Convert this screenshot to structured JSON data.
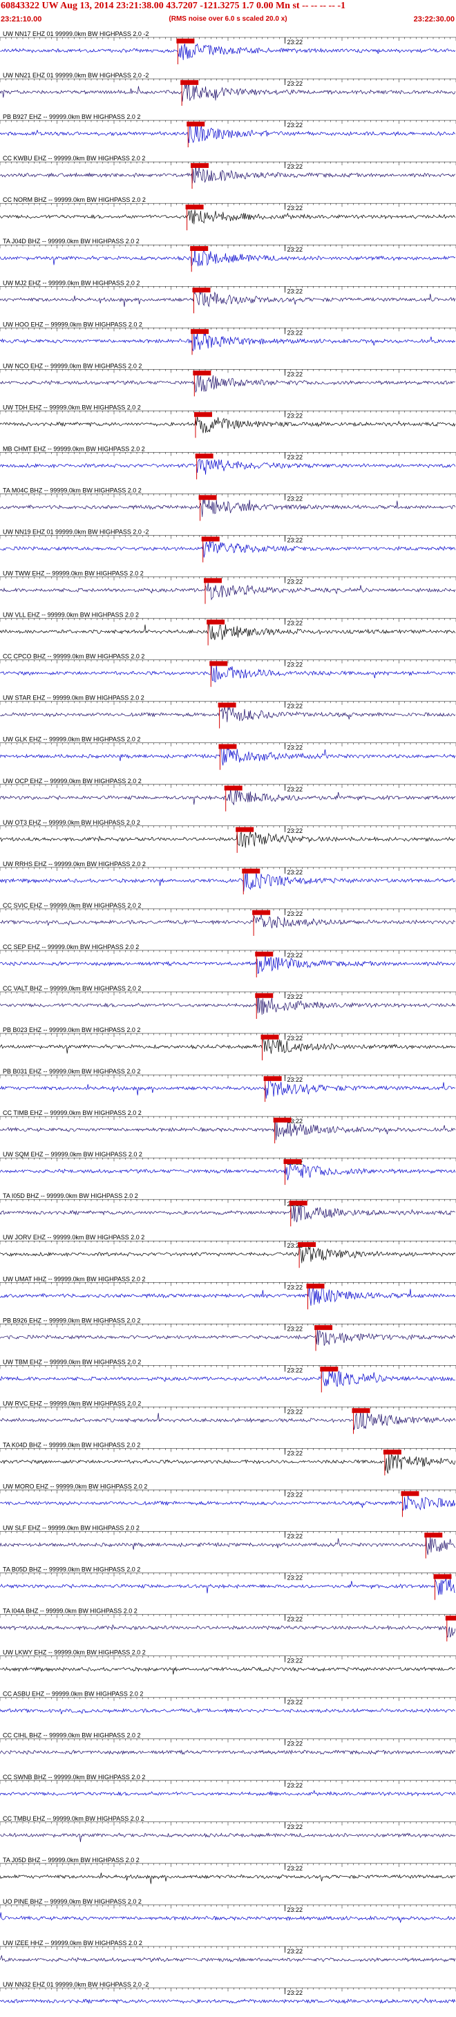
{
  "header": {
    "title": "60843322 UW Aug 13, 2014 23:21:38.00   43.7207 -121.3275  1.7 0.00 Mn st -- -- -- --  -1",
    "start_time": "23:21:10.00",
    "scale_note": "(RMS noise over 6.0 s scaled 20.0 x)",
    "end_time": "23:22:30.00"
  },
  "colors": {
    "pick": "#d40000",
    "trace_blue": "#0000cc",
    "trace_dark": "#1a0a66",
    "trace_black": "#000000",
    "grid": "#000000"
  },
  "chart_data": {
    "type": "line",
    "title": "",
    "xlabel": "",
    "ylabel": "",
    "x_range": [
      "23:21:10.00",
      "23:22:30.00"
    ],
    "minute_tick_label": "23:22",
    "channels": [
      {
        "label": "UW NN17 EHZ 01 99999.0km BW  HIGHPASS  2.0 -2",
        "pick": "23:21:41.2"
      },
      {
        "label": "UW NN21 EHZ 01 99999.0km BW  HIGHPASS  2.0 -2",
        "pick": "23:21:41.9"
      },
      {
        "label": "PB B927 EHZ -- 99999.0km BW  HIGHPASS  2.0  2",
        "pick": "23:21:43.0"
      },
      {
        "label": "CC KWBU EHZ -- 99999.0km BW  HIGHPASS  2.0  2",
        "pick": "23:21:43.7"
      },
      {
        "label": "CC NORM BHZ -- 99999.0km BW  HIGHPASS  2.0  2",
        "pick": "23:21:42.8"
      },
      {
        "label": "TA J04D BHZ -- 99999.0km BW  HIGHPASS  2.0  2",
        "pick": "23:21:43.6"
      },
      {
        "label": "UW MJ2 EHZ -- 99999.0km BW  HIGHPASS  2.0  2",
        "pick": "23:21:44.0"
      },
      {
        "label": "UW HOO EHZ -- 99999.0km BW  HIGHPASS  2.0  2",
        "pick": "23:21:43.7"
      },
      {
        "label": "UW NCO EHZ -- 99999.0km BW  HIGHPASS  2.0  2",
        "pick": "23:21:44.1"
      },
      {
        "label": "UW TDH EHZ -- 99999.0km BW  HIGHPASS  2.0  2",
        "pick": "23:21:44.3"
      },
      {
        "label": "MB CHMT EHZ -- 99999.0km BW  HIGHPASS  2.0  2",
        "pick": "23:21:44.5"
      },
      {
        "label": "TA M04C BHZ -- 99999.0km BW  HIGHPASS  2.0  2",
        "pick": "23:21:45.1"
      },
      {
        "label": "UW NN19 EHZ 01 99999.0km BW  HIGHPASS  2.0 -2",
        "pick": "23:21:45.6"
      },
      {
        "label": "UW TWW EHZ -- 99999.0km BW  HIGHPASS  2.0  2",
        "pick": "23:21:46.0"
      },
      {
        "label": "UW VLL EHZ -- 99999.0km BW  HIGHPASS  2.0  2",
        "pick": "23:21:46.5"
      },
      {
        "label": "CC CPCO BHZ -- 99999.0km BW  HIGHPASS  2.0  2",
        "pick": "23:21:47.0"
      },
      {
        "label": "UW STAR EHZ -- 99999.0km BW  HIGHPASS  2.0  2",
        "pick": "23:21:48.5"
      },
      {
        "label": "UW GLK EHZ -- 99999.0km BW  HIGHPASS  2.0  2",
        "pick": "23:21:48.6"
      },
      {
        "label": "UW OCP EHZ -- 99999.0km BW  HIGHPASS  2.0  2",
        "pick": "23:21:49.6"
      },
      {
        "label": "UW OT3 EHZ -- 99999.0km BW  HIGHPASS  2.0  2",
        "pick": "23:21:51.6"
      },
      {
        "label": "UW RRHS EHZ -- 99999.0km BW  HIGHPASS  2.0  2",
        "pick": "23:21:52.7"
      },
      {
        "label": "CC SVIC EHZ -- 99999.0km BW  HIGHPASS  2.0  2",
        "pick": "23:21:54.5"
      },
      {
        "label": "CC SEP EHZ -- 99999.0km BW  HIGHPASS  2.0  2",
        "pick": "23:21:55.0"
      },
      {
        "label": "CC VALT BHZ -- 99999.0km BW  HIGHPASS  2.0  2",
        "pick": "23:21:55.0"
      },
      {
        "label": "PB B023 EHZ -- 99999.0km BW  HIGHPASS  2.0  2",
        "pick": "23:21:56.0"
      },
      {
        "label": "PB B031 EHZ -- 99999.0km BW  HIGHPASS  2.0  2",
        "pick": "23:21:56.5"
      },
      {
        "label": "CC TIMB EHZ -- 99999.0km BW  HIGHPASS  2.0  2",
        "pick": "23:21:58.2"
      },
      {
        "label": "UW SQM EHZ -- 99999.0km BW  HIGHPASS  2.0  2",
        "pick": "23:22:00.0"
      },
      {
        "label": "TA I05D BHZ -- 99999.0km BW  HIGHPASS  2.0  2",
        "pick": "23:22:01.0"
      },
      {
        "label": "UW JORV EHZ -- 99999.0km BW  HIGHPASS  2.0  2",
        "pick": "23:22:02.5"
      },
      {
        "label": "UW UMAT HHZ -- 99999.0km BW  HIGHPASS  2.0  2",
        "pick": "23:22:04.0"
      },
      {
        "label": "PB B926 EHZ -- 99999.0km BW  HIGHPASS  2.0  2",
        "pick": "23:22:05.4"
      },
      {
        "label": "UW TBM EHZ -- 99999.0km BW  HIGHPASS  2.0  2",
        "pick": "23:22:06.4"
      },
      {
        "label": "UW RVC EHZ -- 99999.0km BW  HIGHPASS  2.0  2",
        "pick": "23:22:12.0"
      },
      {
        "label": "TA K04D BHZ -- 99999.0km BW  HIGHPASS  2.0  2",
        "pick": "23:22:17.5"
      },
      {
        "label": "UW MORO EHZ -- 99999.0km BW  HIGHPASS  2.0  2",
        "pick": "23:22:20.6"
      },
      {
        "label": "UW SLF EHZ -- 99999.0km BW  HIGHPASS  2.0  2",
        "pick": "23:22:24.7"
      },
      {
        "label": "TA B05D BHZ -- 99999.0km BW  HIGHPASS  2.0  2",
        "pick": "23:22:26.3"
      },
      {
        "label": "TA I04A BHZ -- 99999.0km BW  HIGHPASS  2.0  2",
        "pick": "23:22:28.4"
      },
      {
        "label": "UW LKWY EHZ -- 99999.0km BW  HIGHPASS  2.0  2",
        "pick": null
      },
      {
        "label": "CC ASBU EHZ -- 99999.0km BW  HIGHPASS  2.0  2",
        "pick": null
      },
      {
        "label": "CC CIHL BHZ -- 99999.0km BW  HIGHPASS  2.0  2",
        "pick": null
      },
      {
        "label": "CC SWNB BHZ -- 99999.0km BW  HIGHPASS  2.0  2",
        "pick": null
      },
      {
        "label": "CC TMBU EHZ -- 99999.0km BW  HIGHPASS  2.0  2",
        "pick": null
      },
      {
        "label": "TA J05D BHZ -- 99999.0km BW  HIGHPASS  2.0  2",
        "pick": null
      },
      {
        "label": "UO PINE BHZ -- 99999.0km BW  HIGHPASS  2.0  2",
        "pick": null
      },
      {
        "label": "UW IZEE HHZ -- 99999.0km BW  HIGHPASS  2.0  2",
        "pick": null
      },
      {
        "label": "UW NN32 EHZ 01 99999.0km BW  HIGHPASS  2.0 -2",
        "pick": null
      }
    ]
  }
}
